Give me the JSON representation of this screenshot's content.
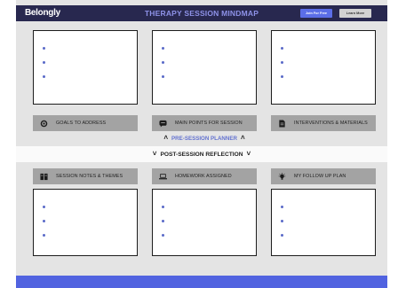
{
  "header": {
    "logo": "Belongly",
    "title": "THERAPY SESSION MINDMAP",
    "join_label": "Join For Free",
    "learn_label": "Learn More"
  },
  "pre_session": {
    "planner_label": "PRE-SESSION PLANNER",
    "sections": [
      {
        "label": "GOALS TO ADDRESS",
        "icon": "target-icon"
      },
      {
        "label": "MAIN POINTS FOR SESSION",
        "icon": "chat-icon"
      },
      {
        "label": "INTERVENTIONS & MATERIALS",
        "icon": "document-icon"
      }
    ]
  },
  "post_session": {
    "reflection_label": "POST-SESSION REFLECTION",
    "sections": [
      {
        "label": "SESSION NOTES & THEMES",
        "icon": "notes-icon"
      },
      {
        "label": "HOMEWORK ASSIGNED",
        "icon": "laptop-icon"
      },
      {
        "label": "MY FOLLOW UP PLAN",
        "icon": "lightbulb-icon"
      }
    ]
  },
  "colors": {
    "header_bg": "#28284f",
    "accent": "#8e92e8",
    "button_blue": "#5b6ee8",
    "footer": "#5163e0",
    "label_bg": "#a3a3a3"
  }
}
